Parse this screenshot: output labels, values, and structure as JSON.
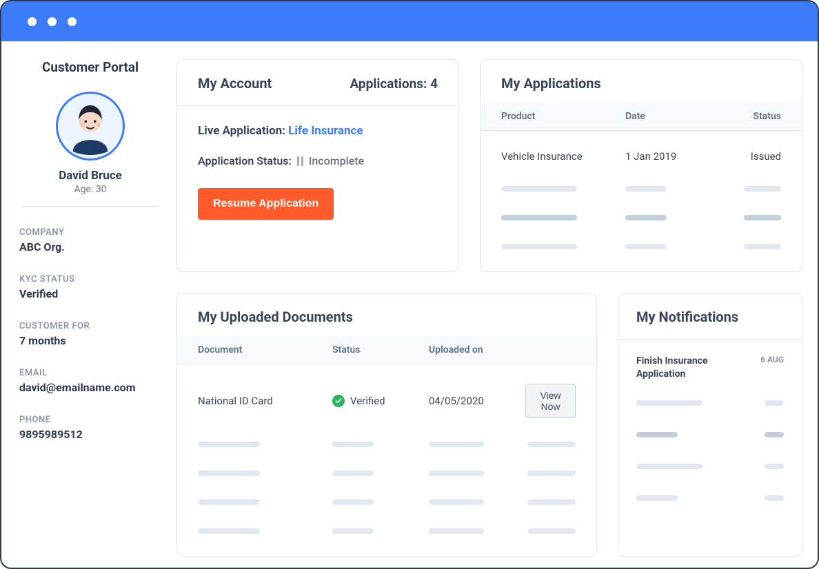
{
  "sidebar": {
    "portal_title": "Customer Portal",
    "profile": {
      "name": "David Bruce",
      "age_label": "Age: 30"
    },
    "info": [
      {
        "label": "COMPANY",
        "value": "ABC Org."
      },
      {
        "label": "KYC STATUS",
        "value": "Verified"
      },
      {
        "label": "CUSTOMER FOR",
        "value": "7 months"
      },
      {
        "label": "EMAIL",
        "value": "david@emailname.com"
      },
      {
        "label": "PHONE",
        "value": "9895989512"
      }
    ]
  },
  "account": {
    "title": "My Account",
    "applications_label": "Applications: 4",
    "live_prefix": "Live Application: ",
    "live_value": "Life Insurance",
    "status_label": "Application Status:",
    "status_value": "Incomplete",
    "resume_label": "Resume Application"
  },
  "applications": {
    "title": "My Applications",
    "headers": {
      "product": "Product",
      "date": "Date",
      "status": "Status"
    },
    "rows": [
      {
        "product": "Vehicle Insurance",
        "date": "1 Jan 2019",
        "status": "Issued"
      }
    ]
  },
  "documents": {
    "title": "My Uploaded Documents",
    "headers": {
      "doc": "Document",
      "status": "Status",
      "uploaded": "Uploaded on"
    },
    "rows": [
      {
        "doc": "National ID Card",
        "status": "Verified",
        "uploaded": "04/05/2020",
        "action": "View Now"
      }
    ]
  },
  "notifications": {
    "title": "My Notifications",
    "rows": [
      {
        "title": "Finish Insurance Application",
        "date": "6 AUG"
      }
    ]
  }
}
